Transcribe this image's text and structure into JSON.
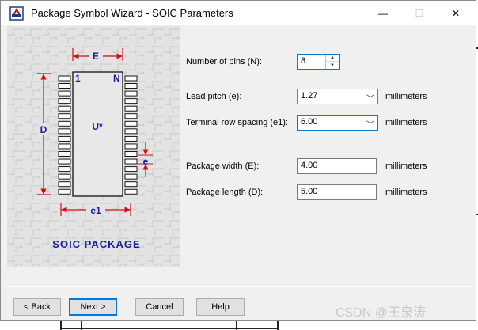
{
  "window": {
    "title": "Package Symbol Wizard - SOIC Parameters"
  },
  "titlebar_buttons": {
    "minimize": "—",
    "maximize": "☐",
    "close": "✕"
  },
  "illustration": {
    "dim_E": "E",
    "dim_D": "D",
    "dim_e": "e",
    "dim_e1": "e1",
    "pin_first": "1",
    "pin_last": "N",
    "part_label": "U*",
    "caption": "SOIC PACKAGE",
    "pins_per_side": 16
  },
  "form": {
    "num_pins": {
      "label": "Number of pins (N):",
      "value": "8"
    },
    "lead_pitch": {
      "label": "Lead pitch (e):",
      "value": "1.27",
      "unit": "millimeters"
    },
    "row_spacing": {
      "label": "Terminal row spacing (e1):",
      "value": "6.00",
      "unit": "millimeters"
    },
    "pkg_width": {
      "label": "Package width (E):",
      "value": "4.00",
      "unit": "millimeters"
    },
    "pkg_length": {
      "label": "Package length (D):",
      "value": "5.00",
      "unit": "millimeters"
    }
  },
  "buttons": {
    "back": "< Back",
    "next": "Next >",
    "cancel": "Cancel",
    "help": "Help"
  },
  "watermark": "CSDN @王泉涛",
  "colors": {
    "accent": "#0078d7",
    "diagram_blue": "#1a1aa6",
    "arrow_red": "#d01010"
  }
}
